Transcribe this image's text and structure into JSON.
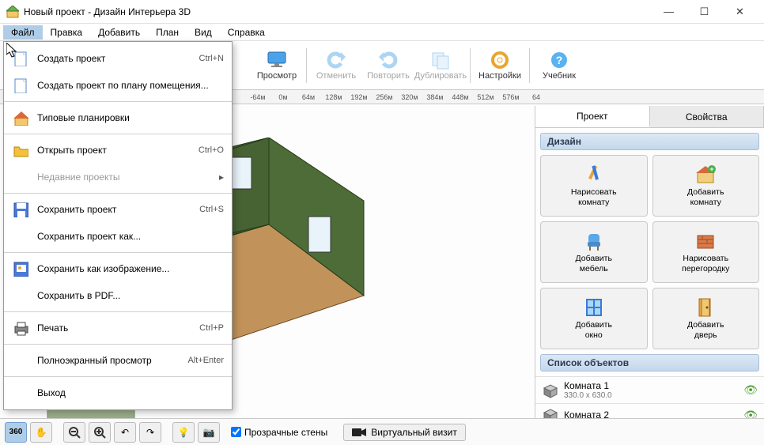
{
  "title": "Новый проект - Дизайн Интерьера 3D",
  "menubar": [
    "Файл",
    "Правка",
    "Добавить",
    "План",
    "Вид",
    "Справка"
  ],
  "toolbar": [
    {
      "label": "Просмотр",
      "icon": "monitor"
    },
    {
      "label": "Отменить",
      "icon": "undo",
      "disabled": true
    },
    {
      "label": "Повторить",
      "icon": "redo",
      "disabled": true
    },
    {
      "label": "Дублировать",
      "icon": "dup",
      "disabled": true
    },
    {
      "label": "Настройки",
      "icon": "gear"
    },
    {
      "label": "Учебник",
      "icon": "help"
    }
  ],
  "ruler": [
    "-64м",
    "0м",
    "64м",
    "128м",
    "192м",
    "256м",
    "320м",
    "384м",
    "448м",
    "512м",
    "576м",
    "64"
  ],
  "file_menu": [
    {
      "label": "Создать проект",
      "shortcut": "Ctrl+N",
      "icon": "new"
    },
    {
      "label": "Создать проект по плану помещения...",
      "icon": "new"
    },
    {
      "sep": true
    },
    {
      "label": "Типовые планировки",
      "icon": "house"
    },
    {
      "sep": true
    },
    {
      "label": "Открыть проект",
      "shortcut": "Ctrl+O",
      "icon": "open"
    },
    {
      "label": "Недавние проекты",
      "submenu": true,
      "disabled": true
    },
    {
      "sep": true
    },
    {
      "label": "Сохранить проект",
      "shortcut": "Ctrl+S",
      "icon": "save"
    },
    {
      "label": "Сохранить проект как..."
    },
    {
      "sep": true
    },
    {
      "label": "Сохранить как изображение...",
      "icon": "saveimg"
    },
    {
      "label": "Сохранить в  PDF..."
    },
    {
      "sep": true
    },
    {
      "label": "Печать",
      "shortcut": "Ctrl+P",
      "icon": "print"
    },
    {
      "sep": true
    },
    {
      "label": "Полноэкранный просмотр",
      "shortcut": "Alt+Enter"
    },
    {
      "sep": true
    },
    {
      "label": "Выход"
    }
  ],
  "sidepanel": {
    "tabs": [
      "Проект",
      "Свойства"
    ],
    "design_hdr": "Дизайн",
    "cards": [
      {
        "l1": "Нарисовать",
        "l2": "комнату",
        "icon": "draw"
      },
      {
        "l1": "Добавить",
        "l2": "комнату",
        "icon": "addroom"
      },
      {
        "l1": "Добавить",
        "l2": "мебель",
        "icon": "chair"
      },
      {
        "l1": "Нарисовать",
        "l2": "перегородку",
        "icon": "wall"
      },
      {
        "l1": "Добавить",
        "l2": "окно",
        "icon": "window"
      },
      {
        "l1": "Добавить",
        "l2": "дверь",
        "icon": "door"
      }
    ],
    "objects_hdr": "Список объектов",
    "objects": [
      {
        "name": "Комната 1",
        "dim": "330.0 x 630.0"
      },
      {
        "name": "Комната 2",
        "dim": ""
      }
    ]
  },
  "statusbar": {
    "transparent_walls": "Прозрачные стены",
    "virtual_visit": "Виртуальный визит"
  }
}
